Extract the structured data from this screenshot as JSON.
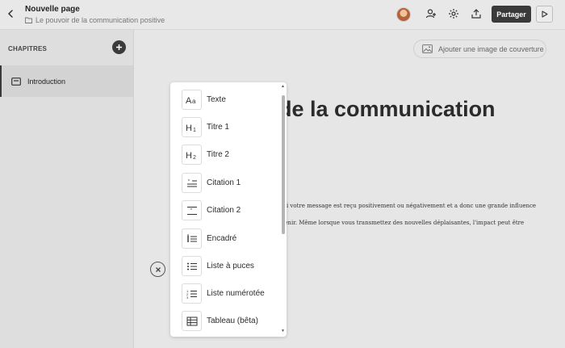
{
  "header": {
    "title": "Nouvelle page",
    "breadcrumb": "Le pouvoir de la communication positive",
    "share_label": "Partager"
  },
  "sidebar": {
    "section_label": "CHAPITRES",
    "items": [
      {
        "label": "Introduction"
      }
    ]
  },
  "main": {
    "cover_button_label": "Ajouter une image de couverture",
    "title_partial": "de la communication",
    "paragraph_lines": [
      "e si votre message est reçu positivement ou négativement et a donc une grande influence",
      "btenir. Même lorsque vous transmettez des nouvelles déplaisantes, l'impact peut être"
    ]
  },
  "block_menu": {
    "items": [
      {
        "label": "Texte",
        "icon": "text-icon"
      },
      {
        "label": "Titre 1",
        "icon": "heading1-icon"
      },
      {
        "label": "Titre 2",
        "icon": "heading2-icon"
      },
      {
        "label": "Citation 1",
        "icon": "quote1-icon"
      },
      {
        "label": "Citation 2",
        "icon": "quote2-icon"
      },
      {
        "label": "Encadré",
        "icon": "callout-icon"
      },
      {
        "label": "Liste à puces",
        "icon": "bullet-list-icon"
      },
      {
        "label": "Liste numérotée",
        "icon": "numbered-list-icon"
      },
      {
        "label": "Tableau (bêta)",
        "icon": "table-icon"
      }
    ]
  },
  "colors": {
    "accent_dark": "#3a3a3a",
    "background": "#e6e6e6",
    "menu_background": "#ffffff"
  }
}
